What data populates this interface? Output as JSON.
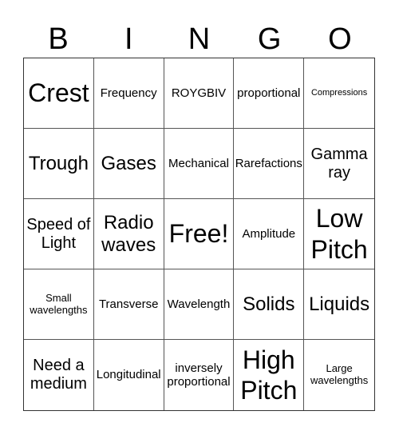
{
  "header": {
    "letters": [
      "B",
      "I",
      "N",
      "G",
      "O"
    ]
  },
  "cells": [
    {
      "text": "Crest",
      "size": "s-xl"
    },
    {
      "text": "Frequency",
      "size": "s-n"
    },
    {
      "text": "ROYGBIV",
      "size": "s-n"
    },
    {
      "text": "proportional",
      "size": "s-n"
    },
    {
      "text": "Compressions",
      "size": "s-xs"
    },
    {
      "text": "Trough",
      "size": "s-l"
    },
    {
      "text": "Gases",
      "size": "s-l"
    },
    {
      "text": "Mechanical",
      "size": "s-n"
    },
    {
      "text": "Rarefactions",
      "size": "s-n"
    },
    {
      "text": "Gamma ray",
      "size": "s-m"
    },
    {
      "text": "Speed of Light",
      "size": "s-m"
    },
    {
      "text": "Radio waves",
      "size": "s-l"
    },
    {
      "text": "Free!",
      "size": "s-xl"
    },
    {
      "text": "Amplitude",
      "size": "s-n"
    },
    {
      "text": "Low Pitch",
      "size": "s-xl"
    },
    {
      "text": "Small wavelengths",
      "size": "s-s"
    },
    {
      "text": "Transverse",
      "size": "s-n"
    },
    {
      "text": "Wavelength",
      "size": "s-n"
    },
    {
      "text": "Solids",
      "size": "s-l"
    },
    {
      "text": "Liquids",
      "size": "s-l"
    },
    {
      "text": "Need a medium",
      "size": "s-m"
    },
    {
      "text": "Longitudinal",
      "size": "s-n"
    },
    {
      "text": "inversely proportional",
      "size": "s-n"
    },
    {
      "text": "High Pitch",
      "size": "s-xl"
    },
    {
      "text": "Large wavelengths",
      "size": "s-s"
    }
  ]
}
